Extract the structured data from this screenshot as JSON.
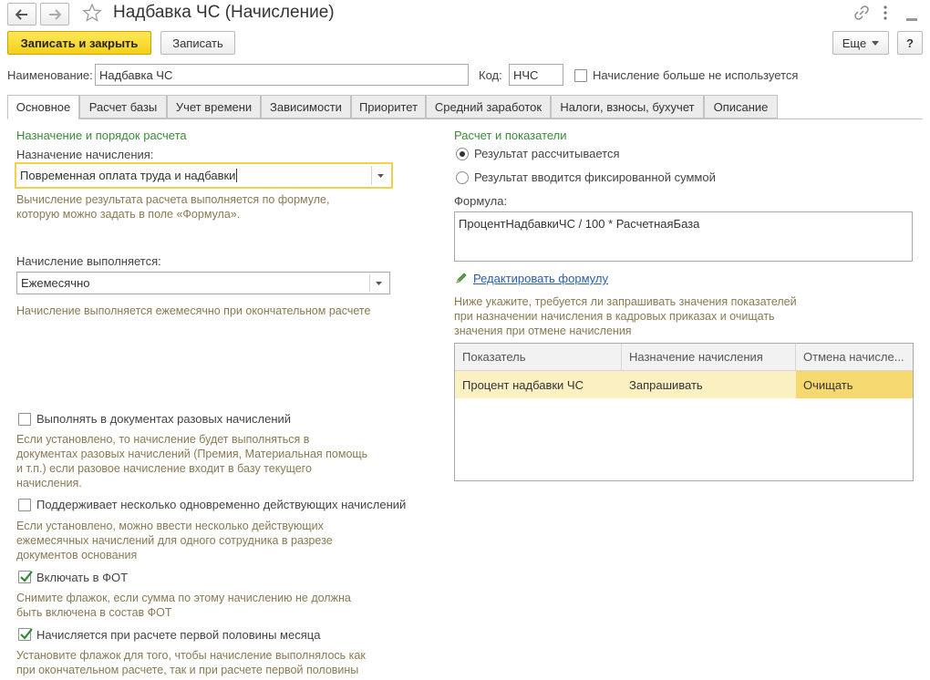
{
  "window": {
    "title": "Надбавка ЧС (Начисление)"
  },
  "toolbar": {
    "save_close_label": "Записать и закрыть",
    "save_label": "Записать",
    "more_label": "Еще",
    "help_label": "?"
  },
  "header": {
    "name_label": "Наименование:",
    "name_value": "Надбавка ЧС",
    "code_label": "Код:",
    "code_value": "НЧС",
    "not_used_label": "Начисление больше не используется"
  },
  "tabs": [
    {
      "label": "Основное"
    },
    {
      "label": "Расчет базы"
    },
    {
      "label": "Учет времени"
    },
    {
      "label": "Зависимости"
    },
    {
      "label": "Приоритет"
    },
    {
      "label": "Средний заработок"
    },
    {
      "label": "Налоги, взносы, бухучет"
    },
    {
      "label": "Описание"
    }
  ],
  "left": {
    "group_title": "Назначение и порядок расчета",
    "purpose_label": "Назначение начисления:",
    "purpose_value": "Повременная оплата труда и надбавки",
    "purpose_hint_1": "Вычисление результата расчета выполняется по формуле,",
    "purpose_hint_2": "которую можно задать в поле «Формула».",
    "schedule_label": "Начисление выполняется:",
    "schedule_value": "Ежемесячно",
    "schedule_hint": "Начисление выполняется ежемесячно при окончательном расчете",
    "checkboxes": [
      {
        "label": "Выполнять в документах разовых начислений",
        "checked": false,
        "hint": [
          "Если установлено, то начисление будет выполняться в",
          "документах разовых начислений (Премия, Материальная помощь",
          "и т.п.) если разовое начисление входит в базу текущего",
          "начисления."
        ]
      },
      {
        "label": "Поддерживает несколько одновременно действующих начислений",
        "checked": false,
        "hint": [
          "Если установлено, можно ввести несколько действующих",
          "ежемесячных начислений для одного сотрудника в разрезе",
          "документов основания"
        ]
      },
      {
        "label": "Включать в ФОТ",
        "checked": true,
        "hint": [
          "Снимите флажок, если сумма по этому начислению не должна",
          "быть включена в состав ФОТ"
        ]
      },
      {
        "label": "Начисляется при расчете первой половины месяца",
        "checked": true,
        "hint": [
          "Установите флажок для того, чтобы начисление выполнялось как",
          "при окончательном расчете, так и при расчете первой половины"
        ]
      }
    ]
  },
  "right": {
    "group_title": "Расчет и показатели",
    "radio_calc": "Результат рассчитывается",
    "radio_fixed": "Результат вводится фиксированной суммой",
    "formula_label": "Формула:",
    "formula_value": "ПроцентНадбавкиЧС / 100 * РасчетнаяБаза",
    "edit_formula_link": "Редактировать формулу",
    "indicators_hint_1": "Ниже укажите, требуется ли запрашивать значения показателей",
    "indicators_hint_2": "при назначении начисления в кадровых приказах и очищать",
    "indicators_hint_3": "значения при отмене начисления",
    "table": {
      "headers": [
        "Показатель",
        "Назначение начисления",
        "Отмена начисле..."
      ],
      "rows": [
        [
          "Процент надбавки ЧС",
          "Запрашивать",
          "Очищать"
        ]
      ]
    }
  },
  "colors": {
    "accent_yellow": "#f5cf19",
    "group_green": "#3c8a3c",
    "hint_brown": "#8a7a52",
    "link_blue": "#2a5ea8",
    "row_highlight": "#fbf0c2"
  }
}
